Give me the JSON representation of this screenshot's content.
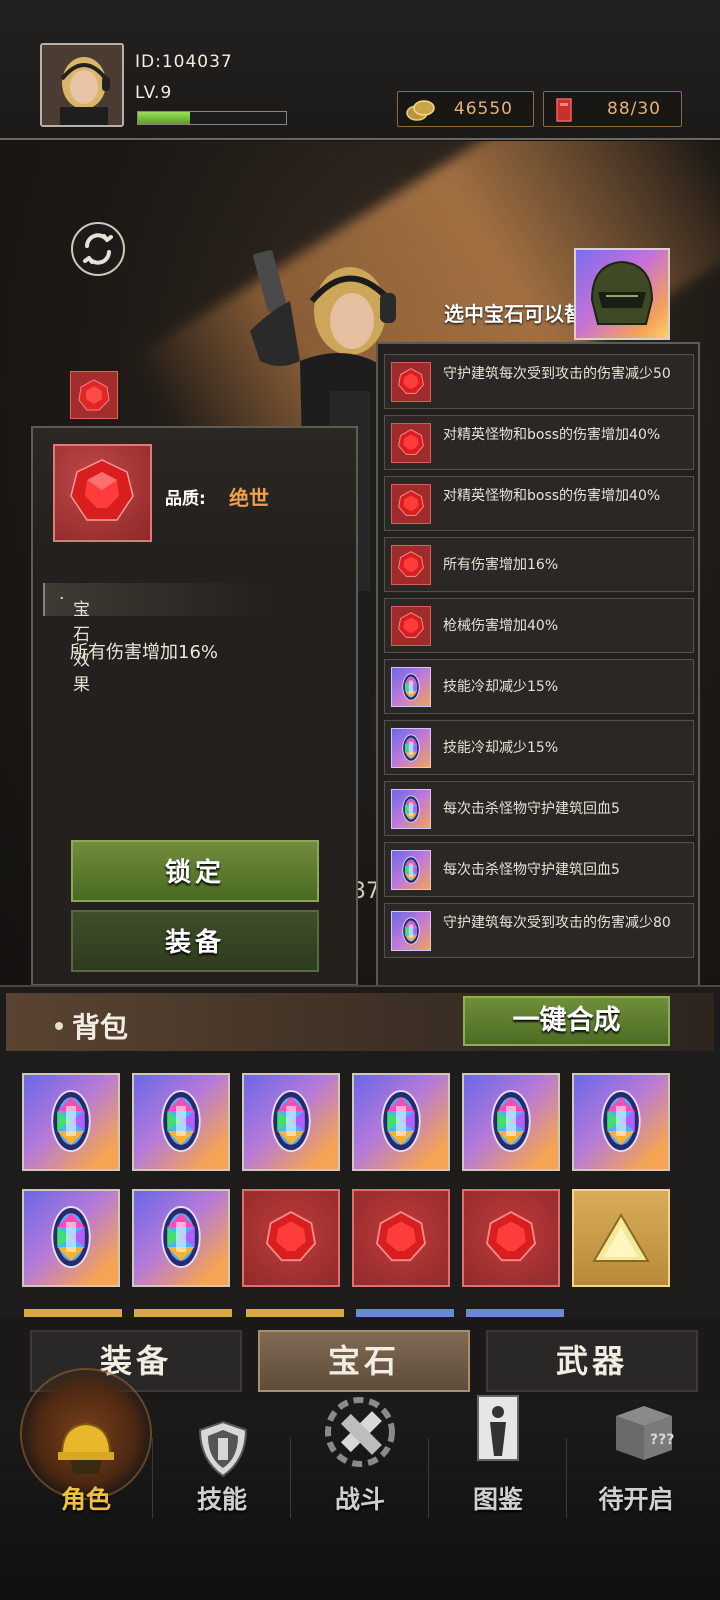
{
  "player": {
    "id": "ID:104037",
    "level": "LV.9",
    "xp_fraction": 0.35
  },
  "resources": {
    "gold": "46550",
    "cards": "88/30"
  },
  "scene": {
    "hint": "选中宝石可以替换",
    "partial_number": "37"
  },
  "detail": {
    "quality_label": "品质:",
    "quality_value": "绝世",
    "effect_header": "宝石效果",
    "effect_text": "所有伤害增加16%",
    "lock_button": "锁定",
    "equip_button": "装备"
  },
  "gem_list": [
    {
      "type": "red",
      "text": "守护建筑每次受到攻击的伤害减少50"
    },
    {
      "type": "red",
      "text": "对精英怪物和boss的伤害增加40%"
    },
    {
      "type": "red",
      "text": "对精英怪物和boss的伤害增加40%"
    },
    {
      "type": "red",
      "text": "所有伤害增加16%"
    },
    {
      "type": "red",
      "text": "枪械伤害增加40%"
    },
    {
      "type": "rainbow",
      "text": "技能冷却减少15%"
    },
    {
      "type": "rainbow",
      "text": "技能冷却减少15%"
    },
    {
      "type": "rainbow",
      "text": "每次击杀怪物守护建筑回血5"
    },
    {
      "type": "rainbow",
      "text": "每次击杀怪物守护建筑回血5"
    },
    {
      "type": "rainbow",
      "text": "守护建筑每次受到攻击的伤害减少80"
    }
  ],
  "bag": {
    "title": "背包",
    "merge_button": "一键合成",
    "items": [
      "rainbow",
      "rainbow",
      "rainbow",
      "rainbow",
      "rainbow",
      "rainbow",
      "rainbow",
      "rainbow",
      "red",
      "red",
      "red",
      "gold"
    ]
  },
  "tabs": [
    {
      "label": "装备",
      "active": false
    },
    {
      "label": "宝石",
      "active": true
    },
    {
      "label": "武器",
      "active": false
    }
  ],
  "nav": [
    {
      "label": "角色",
      "icon": "helmet-icon",
      "active": true
    },
    {
      "label": "技能",
      "icon": "shield-icon",
      "active": false
    },
    {
      "label": "战斗",
      "icon": "crossed-swords-icon",
      "active": false
    },
    {
      "label": "图鉴",
      "icon": "codex-icon",
      "active": false
    },
    {
      "label": "待开启",
      "icon": "locked-box-icon",
      "active": false
    }
  ],
  "colors": {
    "quality": "#f0a04a",
    "resource_text": "#e6b27a",
    "active_nav": "#f0c040",
    "green_button": "#5a7a2e"
  }
}
